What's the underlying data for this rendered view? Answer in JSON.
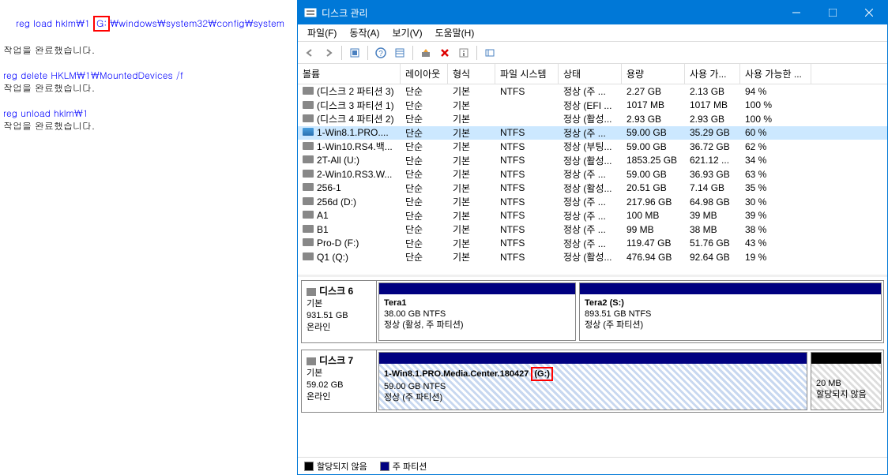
{
  "cmd": {
    "line1_prefix": "reg load hklm\\1 ",
    "line1_drive": "G:",
    "line1_suffix": "\\windows\\system32\\config\\system",
    "done": "작업을 완료했습니다.",
    "line2": "reg delete HKLM\\1\\MountedDevices /f",
    "line3": "reg unload hklm\\1"
  },
  "titlebar": {
    "title": "디스크 관리"
  },
  "menu": {
    "file": "파일(F)",
    "action": "동작(A)",
    "view": "보기(V)",
    "help": "도움말(H)"
  },
  "headers": {
    "volume": "볼륨",
    "layout": "레이아웃",
    "type": "형식",
    "fs": "파일 시스템",
    "status": "상태",
    "capacity": "용량",
    "free": "사용 가...",
    "pct": "사용 가능한 ..."
  },
  "volumes": [
    {
      "name": "(디스크 2 파티션 3)",
      "layout": "단순",
      "type": "기본",
      "fs": "NTFS",
      "status": "정상 (주 ...",
      "cap": "2.27 GB",
      "free": "2.13 GB",
      "pct": "94 %",
      "icon": ""
    },
    {
      "name": "(디스크 3 파티션 1)",
      "layout": "단순",
      "type": "기본",
      "fs": "",
      "status": "정상 (EFI ...",
      "cap": "1017 MB",
      "free": "1017 MB",
      "pct": "100 %",
      "icon": ""
    },
    {
      "name": "(디스크 4 파티션 2)",
      "layout": "단순",
      "type": "기본",
      "fs": "",
      "status": "정상 (활성...",
      "cap": "2.93 GB",
      "free": "2.93 GB",
      "pct": "100 %",
      "icon": ""
    },
    {
      "name": "1-Win8.1.PRO....",
      "layout": "단순",
      "type": "기본",
      "fs": "NTFS",
      "status": "정상 (주 ...",
      "cap": "59.00 GB",
      "free": "35.29 GB",
      "pct": "60 %",
      "icon": "blue",
      "selected": true
    },
    {
      "name": "1-Win10.RS4.백...",
      "layout": "단순",
      "type": "기본",
      "fs": "NTFS",
      "status": "정상 (부팅...",
      "cap": "59.00 GB",
      "free": "36.72 GB",
      "pct": "62 %",
      "icon": ""
    },
    {
      "name": "2T-All (U:)",
      "layout": "단순",
      "type": "기본",
      "fs": "NTFS",
      "status": "정상 (활성...",
      "cap": "1853.25 GB",
      "free": "621.12 ...",
      "pct": "34 %",
      "icon": ""
    },
    {
      "name": "2-Win10.RS3.W...",
      "layout": "단순",
      "type": "기본",
      "fs": "NTFS",
      "status": "정상 (주 ...",
      "cap": "59.00 GB",
      "free": "36.93 GB",
      "pct": "63 %",
      "icon": ""
    },
    {
      "name": "256-1",
      "layout": "단순",
      "type": "기본",
      "fs": "NTFS",
      "status": "정상 (활성...",
      "cap": "20.51 GB",
      "free": "7.14 GB",
      "pct": "35 %",
      "icon": ""
    },
    {
      "name": "256d (D:)",
      "layout": "단순",
      "type": "기본",
      "fs": "NTFS",
      "status": "정상 (주 ...",
      "cap": "217.96 GB",
      "free": "64.98 GB",
      "pct": "30 %",
      "icon": ""
    },
    {
      "name": "A1",
      "layout": "단순",
      "type": "기본",
      "fs": "NTFS",
      "status": "정상 (주 ...",
      "cap": "100 MB",
      "free": "39 MB",
      "pct": "39 %",
      "icon": ""
    },
    {
      "name": "B1",
      "layout": "단순",
      "type": "기본",
      "fs": "NTFS",
      "status": "정상 (주 ...",
      "cap": "99 MB",
      "free": "38 MB",
      "pct": "38 %",
      "icon": ""
    },
    {
      "name": "Pro-D (F:)",
      "layout": "단순",
      "type": "기본",
      "fs": "NTFS",
      "status": "정상 (주 ...",
      "cap": "119.47 GB",
      "free": "51.76 GB",
      "pct": "43 %",
      "icon": ""
    },
    {
      "name": "Q1 (Q:)",
      "layout": "단순",
      "type": "기본",
      "fs": "NTFS",
      "status": "정상 (활성...",
      "cap": "476.94 GB",
      "free": "92.64 GB",
      "pct": "19 %",
      "icon": ""
    }
  ],
  "disk6": {
    "label": "디스크 6",
    "type": "기본",
    "size": "931.51 GB",
    "status": "온라인",
    "p1": {
      "name": "Tera1",
      "info": "38.00 GB NTFS",
      "status": "정상 (활성, 주 파티션)"
    },
    "p2": {
      "name": "Tera2  (S:)",
      "info": "893.51 GB NTFS",
      "status": "정상 (주 파티션)"
    }
  },
  "disk7": {
    "label": "디스크 7",
    "type": "기본",
    "size": "59.02 GB",
    "status": "온라인",
    "p1_name_prefix": "1-Win8.1.PRO.Media.Center.180427 ",
    "p1_drive": "(G:)",
    "p1_info": "59.00 GB NTFS",
    "p1_status": "정상 (주 파티션)",
    "p2_info": "20 MB",
    "p2_status": "할당되지 않음"
  },
  "legend": {
    "unalloc": "할당되지 않음",
    "primary": "주 파티션"
  }
}
